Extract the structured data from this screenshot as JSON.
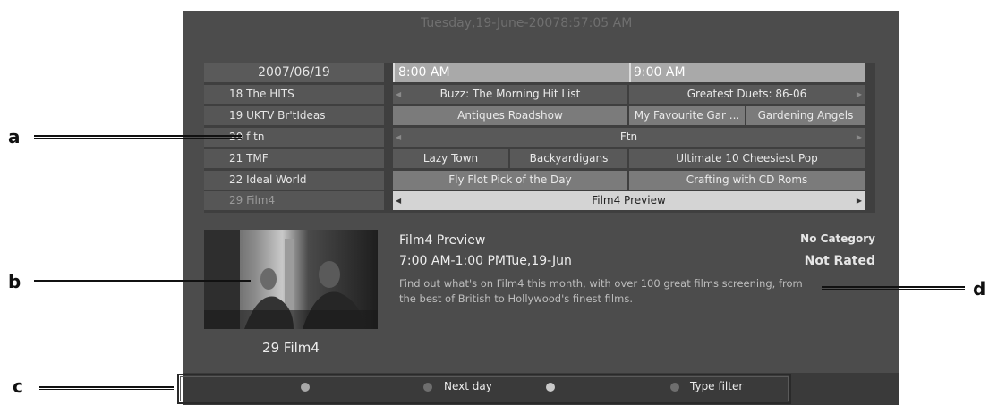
{
  "header": {
    "datetime": "Tuesday,19-June-20078:57:05 AM"
  },
  "guide": {
    "date": "2007/06/19",
    "times": [
      "8:00 AM",
      "9:00 AM"
    ],
    "channels": [
      {
        "label": "18 The HITS",
        "programmes": [
          {
            "title": "Buzz: The Morning Hit List"
          },
          {
            "title": "Greatest Duets: 86-06"
          }
        ]
      },
      {
        "label": "19 UKTV Br'tIdeas",
        "programmes": [
          {
            "title": "Antiques Roadshow"
          },
          {
            "title": "My Favourite Gar ..."
          },
          {
            "title": "Gardening Angels"
          }
        ]
      },
      {
        "label": "20 f tn",
        "programmes": [
          {
            "title": "Ftn"
          }
        ]
      },
      {
        "label": "21 TMF",
        "programmes": [
          {
            "title": "Lazy Town"
          },
          {
            "title": "Backyardigans"
          },
          {
            "title": "Ultimate 10 Cheesiest Pop"
          }
        ]
      },
      {
        "label": "22 Ideal World",
        "programmes": [
          {
            "title": "Fly Flot Pick of the Day"
          },
          {
            "title": "Crafting with CD Roms"
          }
        ]
      },
      {
        "label": "29 Film4",
        "programmes": [
          {
            "title": "Film4 Preview"
          }
        ]
      }
    ]
  },
  "preview": {
    "channel": "29  Film4"
  },
  "details": {
    "title": "Film4 Preview",
    "time": "7:00 AM-1:00 PMTue,19-Jun",
    "description": "Find out what's on Film4 this month, with over 100 great films screening, from the best of British to Hollywood's finest films.",
    "category": "No Category",
    "rating": "Not Rated"
  },
  "footer": {
    "buttons": [
      {
        "label": "",
        "color": "#a8a8a8"
      },
      {
        "label": "Next day",
        "color": "#6e6e6e"
      },
      {
        "label": "",
        "color": "#c9c9c9"
      },
      {
        "label": "Type filter",
        "color": "#6e6e6e"
      }
    ]
  },
  "callouts": [
    "a",
    "b",
    "c",
    "d"
  ]
}
